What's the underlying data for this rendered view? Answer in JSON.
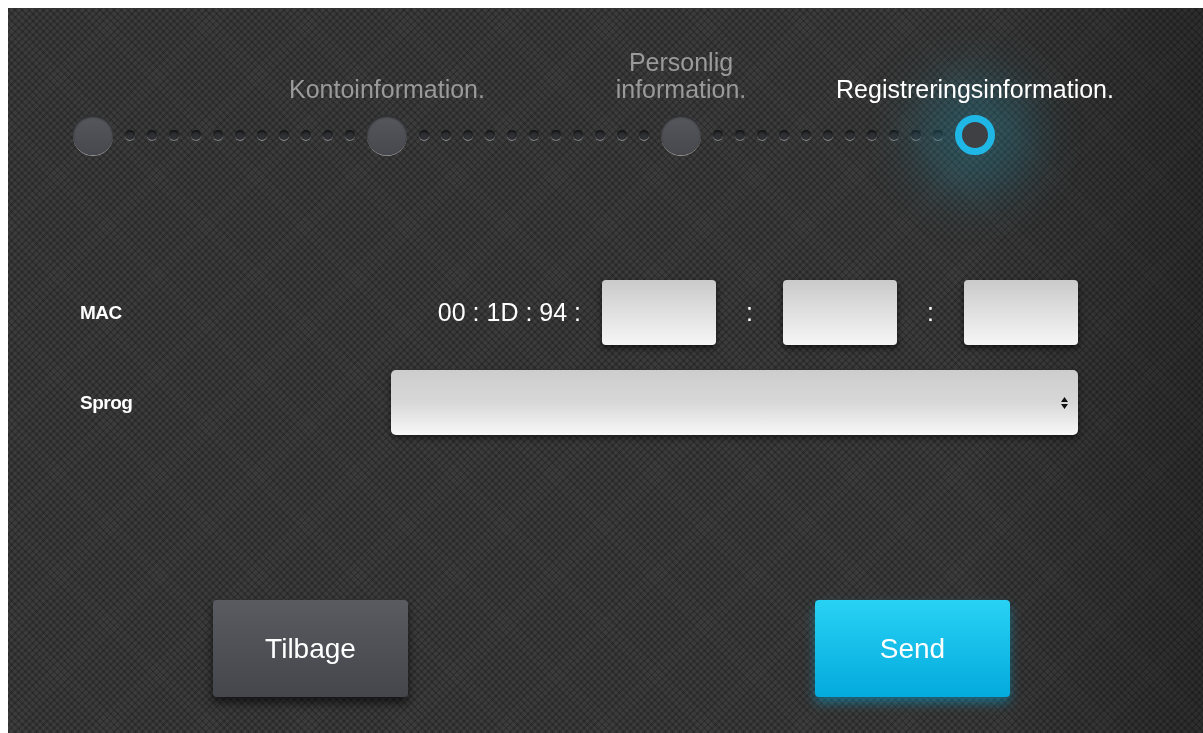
{
  "steps": [
    {
      "selected": false
    },
    {
      "label": "Kontoinformation.",
      "selected": false
    },
    {
      "label": "Personlig information.",
      "selected": false
    },
    {
      "label": "Registreringsinformation.",
      "selected": true
    }
  ],
  "form": {
    "rows": [
      {
        "kind": "mac",
        "label": "MAC",
        "prefix": "00 : 1D : 94 :",
        "parts": [
          {
            "kind": "field"
          },
          {
            "kind": "separator",
            "text": ":"
          },
          {
            "kind": "field"
          },
          {
            "kind": "separator",
            "text": ":"
          },
          {
            "kind": "field"
          }
        ]
      },
      {
        "kind": "select",
        "label": "Sprog"
      }
    ]
  },
  "buttons": [
    {
      "label": "Tilbage",
      "kind": "secondary"
    },
    {
      "label": "Send",
      "kind": "primary"
    }
  ]
}
